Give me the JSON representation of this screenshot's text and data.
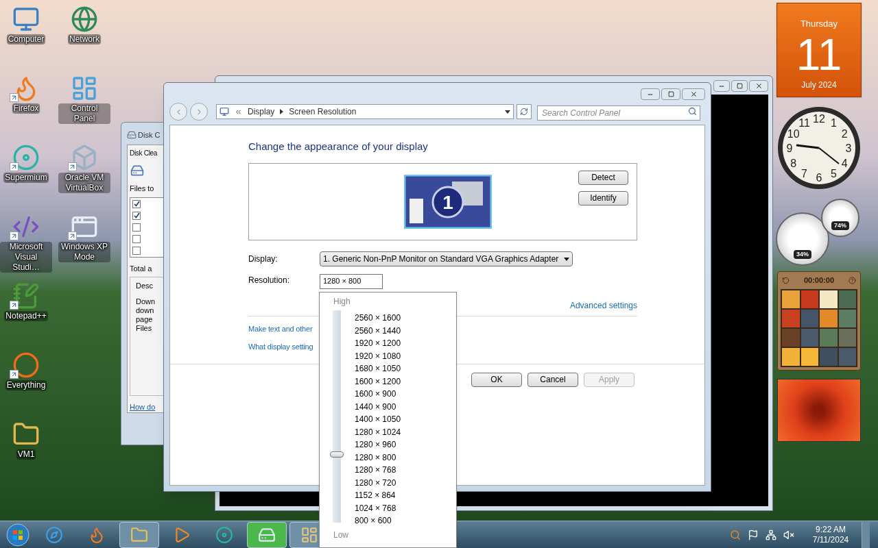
{
  "desktop_icons": [
    {
      "label": "Computer",
      "kind": "monitor",
      "shortcut": false
    },
    {
      "label": "Firefox",
      "kind": "flame",
      "shortcut": true
    },
    {
      "label": "Supermium",
      "kind": "disc",
      "shortcut": true
    },
    {
      "label": "Microsoft Visual Studi…",
      "kind": "code",
      "shortcut": true
    },
    {
      "label": "Notepad++",
      "kind": "notebook",
      "shortcut": true
    },
    {
      "label": "Everything",
      "kind": "ring",
      "shortcut": true
    },
    {
      "label": "VM1",
      "kind": "folder",
      "shortcut": false
    },
    {
      "label": "Network",
      "kind": "globe",
      "shortcut": false
    },
    {
      "label": "Control Panel",
      "kind": "panel",
      "shortcut": false
    },
    {
      "label": "Oracle VM VirtualBox",
      "kind": "box",
      "shortcut": true
    },
    {
      "label": "Windows XP Mode",
      "kind": "window",
      "shortcut": true
    }
  ],
  "gadgets": {
    "calendar": {
      "weekday": "Thursday",
      "day": "11",
      "month": "July 2024"
    },
    "clock": {
      "numerals": [
        "12",
        "11",
        "1",
        "10",
        "2",
        "9",
        "3",
        "8",
        "4",
        "7",
        "5",
        "6"
      ]
    },
    "cpu_meter": {
      "cpu": "34%",
      "memory": "74%"
    },
    "puzzle": {
      "timer": "00:00:00"
    }
  },
  "disk_cleanup": {
    "title": "Disk C",
    "tab": "Disk Clea",
    "files_label": "Files to",
    "files": [
      {
        "checked": true
      },
      {
        "checked": true
      },
      {
        "checked": false
      },
      {
        "checked": false
      },
      {
        "checked": false
      }
    ],
    "total": "Total a",
    "group": "Desc",
    "description": [
      "Down",
      "down",
      "page",
      "Files"
    ],
    "link": "How do"
  },
  "window": {
    "breadcrumb": [
      "Display",
      "Screen Resolution"
    ],
    "search": {
      "placeholder": "Search Control Panel"
    },
    "heading": "Change the appearance of your display",
    "monitor_number": "1",
    "preview_buttons": [
      "Detect",
      "Identify"
    ],
    "display": {
      "label": "Display:",
      "value": "1. Generic Non-PnP Monitor on Standard VGA Graphics Adapter"
    },
    "resolution": {
      "label": "Resolution:",
      "value": "1280 × 800"
    },
    "advanced_link": "Advanced settings",
    "links": [
      "Make text and other",
      "What display setting"
    ],
    "buttons": [
      {
        "label": "OK",
        "disabled": false
      },
      {
        "label": "Cancel",
        "disabled": false
      },
      {
        "label": "Apply",
        "disabled": true
      }
    ]
  },
  "resolution_list": {
    "high": "High",
    "low": "Low",
    "level": 0.3125,
    "options": [
      "2560 × 1600",
      "2560 × 1440",
      "1920 × 1200",
      "1920 × 1080",
      "1680 × 1050",
      "1600 × 1200",
      "1600 × 900",
      "1440 × 900",
      "1400 × 1050",
      "1280 × 1024",
      "1280 × 960",
      "1280 × 800",
      "1280 × 768",
      "1280 × 720",
      "1152 × 864",
      "1024 × 768",
      "800 × 600"
    ]
  },
  "taskbar": {
    "apps": [
      {
        "kind": "ie",
        "open": false,
        "selected": false
      },
      {
        "kind": "firefox",
        "open": false,
        "selected": false
      },
      {
        "kind": "explorer",
        "open": true,
        "selected": false
      },
      {
        "kind": "media",
        "open": false,
        "selected": false
      },
      {
        "kind": "supermium",
        "open": false,
        "selected": false
      },
      {
        "kind": "cleanup",
        "open": true,
        "selected": true
      },
      {
        "kind": "panel",
        "open": true,
        "selected": false
      }
    ],
    "time": "9:22 AM",
    "date": "7/11/2024"
  }
}
